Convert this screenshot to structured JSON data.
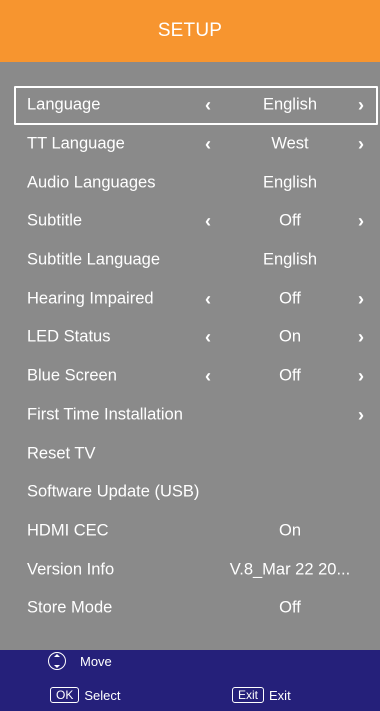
{
  "header": {
    "title": "SETUP"
  },
  "colors": {
    "header_bg": "#f7952f",
    "panel_bg": "#8a8a8a",
    "footer_bg": "#25207a",
    "text": "#ffffff"
  },
  "menu": [
    {
      "label": "Language",
      "value": "English",
      "left_arrow": "‹",
      "right_arrow": "›"
    },
    {
      "label": "TT Language",
      "value": "West",
      "left_arrow": "‹",
      "right_arrow": "›"
    },
    {
      "label": "Audio Languages",
      "value": "English"
    },
    {
      "label": "Subtitle",
      "value": "Off",
      "left_arrow": "‹",
      "right_arrow": "›"
    },
    {
      "label": "Subtitle Language",
      "value": "English"
    },
    {
      "label": "Hearing Impaired",
      "value": "Off",
      "left_arrow": "‹",
      "right_arrow": "›"
    },
    {
      "label": "LED Status",
      "value": "On",
      "left_arrow": "‹",
      "right_arrow": "›"
    },
    {
      "label": "Blue Screen",
      "value": "Off",
      "left_arrow": "‹",
      "right_arrow": "›"
    },
    {
      "label": "First Time Installation",
      "right_arrow": "›"
    },
    {
      "label": "Reset TV"
    },
    {
      "label": "Software Update (USB)"
    },
    {
      "label": "HDMI CEC",
      "value": "On"
    },
    {
      "label": "Version Info",
      "value": "V.8_Mar 22 20..."
    },
    {
      "label": "Store Mode",
      "value": "Off"
    }
  ],
  "footer": {
    "move_icon": "dpad-up-down-icon",
    "move_label": "Move",
    "ok_key": "OK",
    "select_label": "Select",
    "exit_key": "Exit",
    "exit_label": "Exit"
  }
}
